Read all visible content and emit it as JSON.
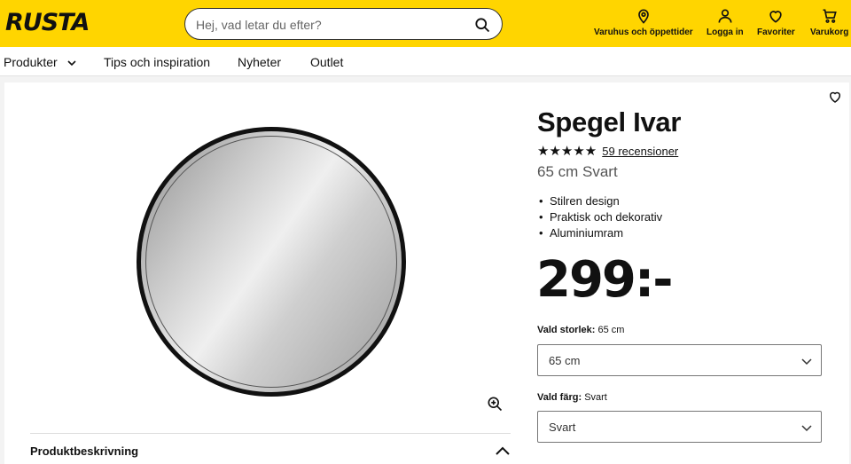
{
  "header": {
    "logo": "RUSTA",
    "search_placeholder": "Hej, vad letar du efter?",
    "nav": [
      {
        "label": "Varuhus och öppettider",
        "icon": "location-pin-icon"
      },
      {
        "label": "Logga in",
        "icon": "user-icon"
      },
      {
        "label": "Favoriter",
        "icon": "heart-icon"
      },
      {
        "label": "Varukorg",
        "icon": "cart-icon"
      }
    ],
    "accent_color": "#ffd500"
  },
  "category_nav": [
    {
      "label": "Produkter"
    },
    {
      "label": "Tips och inspiration"
    },
    {
      "label": "Nyheter"
    },
    {
      "label": "Outlet"
    }
  ],
  "product": {
    "title": "Spegel Ivar",
    "rating_stars": "★★★★★",
    "rating_value": 5,
    "reviews": "59 recensioner",
    "variant": "65 cm Svart",
    "features": [
      "Stilren design",
      "Praktisk och dekorativ",
      "Aluminiumram"
    ],
    "price": "299:-",
    "size_label": "Vald storlek:",
    "size_value": "65 cm",
    "size_selected": "65 cm",
    "color_label": "Vald färg:",
    "color_value": "Svart",
    "color_selected": "Svart",
    "description_title": "Produktbeskrivning"
  }
}
